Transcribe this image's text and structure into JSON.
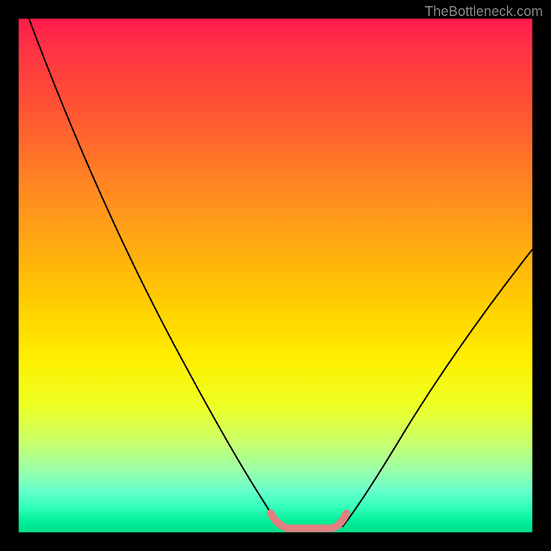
{
  "watermark": "TheBottleneck.com",
  "chart_data": {
    "type": "line",
    "title": "",
    "xlabel": "",
    "ylabel": "",
    "xlim": [
      0,
      100
    ],
    "ylim": [
      0,
      100
    ],
    "series": [
      {
        "name": "bottleneck-curve",
        "x": [
          2,
          10,
          20,
          30,
          40,
          48,
          52,
          56,
          60,
          63,
          70,
          80,
          90,
          100
        ],
        "y": [
          100,
          85,
          68,
          50,
          32,
          10,
          2,
          1,
          1,
          2,
          12,
          28,
          42,
          55
        ]
      }
    ],
    "annotations": [
      {
        "name": "optimal-zone",
        "x_range": [
          48,
          63
        ],
        "style": "pink-highlight"
      }
    ],
    "gradient_stops": [
      {
        "pos": 0,
        "color": "#ff1a4d"
      },
      {
        "pos": 18,
        "color": "#ff5533"
      },
      {
        "pos": 44,
        "color": "#ffaa11"
      },
      {
        "pos": 66,
        "color": "#ffee00"
      },
      {
        "pos": 88,
        "color": "#99ffaa"
      },
      {
        "pos": 100,
        "color": "#00dd88"
      }
    ]
  }
}
